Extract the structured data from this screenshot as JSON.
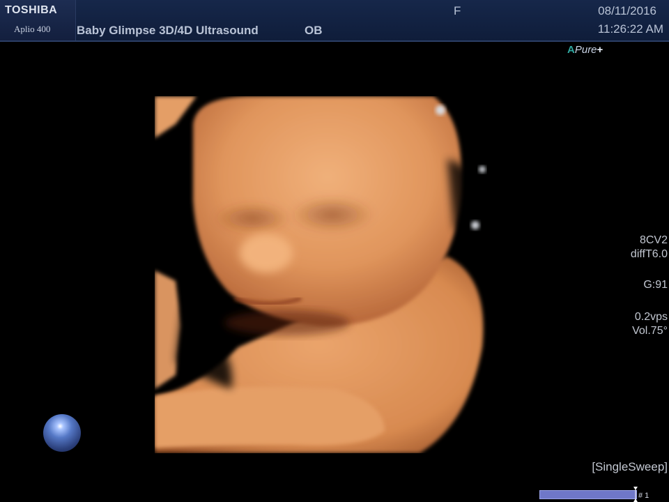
{
  "header": {
    "brand": "TOSHIBA",
    "model": "Aplio 400",
    "title": "Baby Glimpse 3D/4D Ultrasound",
    "exam_type": "OB",
    "flag": "F",
    "date": "08/11/2016",
    "time": "11:26:22 AM"
  },
  "logo": {
    "a": "A",
    "text": "Pure",
    "plus": "+"
  },
  "image_params": {
    "probe": "8CV2",
    "mode": "diffT6.0",
    "gain": "G:91",
    "rate": "0.2vps",
    "volume": "Vol.75°"
  },
  "sweep_mode": "[SingleSweep]",
  "cine": {
    "label": "# 1",
    "position": 1.0
  },
  "colors": {
    "header_bg": "#16274a",
    "skin": "#e29a62",
    "bar": "#6f77c8"
  },
  "icons": {
    "orientation": "orientation-sphere-icon",
    "cine_marker": "cine-marker-icon"
  }
}
